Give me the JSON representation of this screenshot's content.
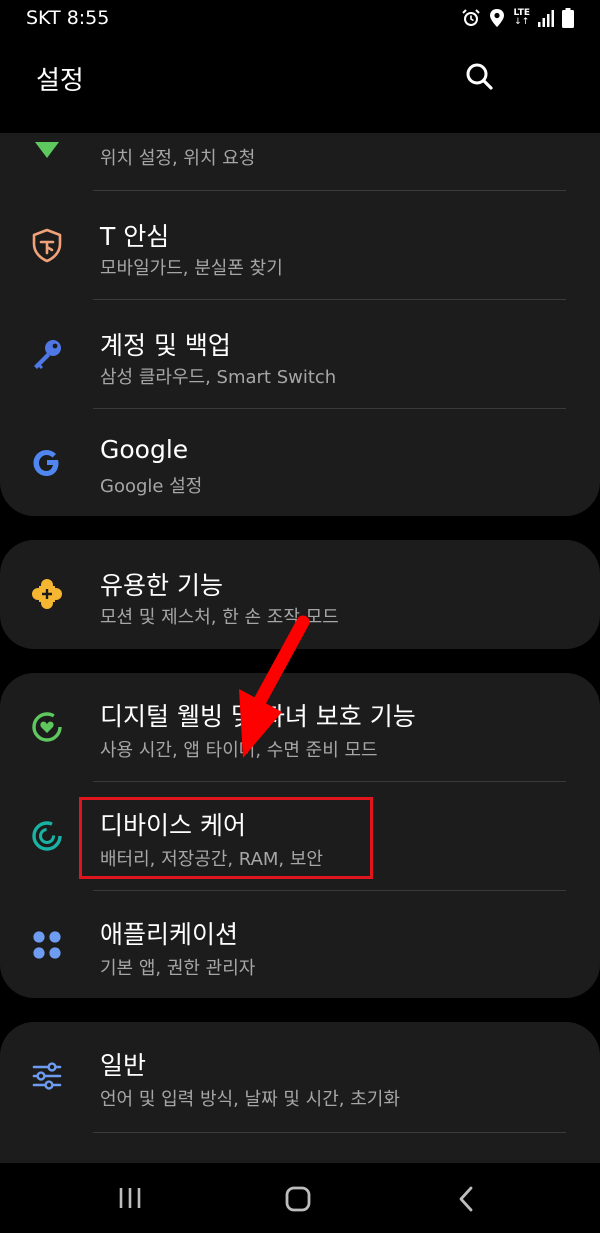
{
  "status_bar": {
    "carrier_time": "SKT 8:55",
    "network": "LTE",
    "icons": [
      "alarm-icon",
      "location-icon",
      "lte-icon",
      "signal-icon",
      "battery-icon"
    ]
  },
  "header": {
    "title": "설정",
    "search_icon": "search-icon"
  },
  "cards": [
    {
      "items": [
        {
          "title": "",
          "subtitle": "위치 설정, 위치 요청",
          "icon": "location-pin-icon",
          "color": "#5ec75e"
        },
        {
          "title": "T 안심",
          "subtitle": "모바일가드, 분실폰 찾기",
          "icon": "shield-icon",
          "color": "#f0a37a"
        },
        {
          "title": "계정 및 백업",
          "subtitle": "삼성 클라우드, Smart Switch",
          "icon": "key-icon",
          "color": "#4f78e6"
        },
        {
          "title": "Google",
          "subtitle": "Google 설정",
          "icon": "google-icon",
          "color": "#4f86f0"
        }
      ]
    },
    {
      "items": [
        {
          "title": "유용한 기능",
          "subtitle": "모션 및 제스처, 한 손 조작 모드",
          "icon": "puzzle-icon",
          "color": "#f5b731"
        }
      ]
    },
    {
      "items": [
        {
          "title": "디지털 웰빙 및 자녀 보호 기능",
          "subtitle": "사용 시간, 앱 타이머, 수면 준비 모드",
          "icon": "wellbeing-icon",
          "color": "#5ec75e"
        },
        {
          "title": "디바이스 케어",
          "subtitle": "배터리, 저장공간, RAM, 보안",
          "icon": "device-care-icon",
          "color": "#19b3a3"
        },
        {
          "title": "애플리케이션",
          "subtitle": "기본 앱, 권한 관리자",
          "icon": "apps-grid-icon",
          "color": "#6e9cf0"
        }
      ]
    },
    {
      "items": [
        {
          "title": "일반",
          "subtitle": "언어 및 입력 방식, 날짜 및 시간, 초기화",
          "icon": "sliders-icon",
          "color": "#6e9cf0"
        }
      ]
    }
  ],
  "annotation": {
    "highlight_color": "#e0161f",
    "arrow_color": "#ff0000"
  },
  "nav_bar": {
    "recent_icon": "recent-apps-icon",
    "home_icon": "home-icon",
    "back_icon": "back-icon"
  }
}
